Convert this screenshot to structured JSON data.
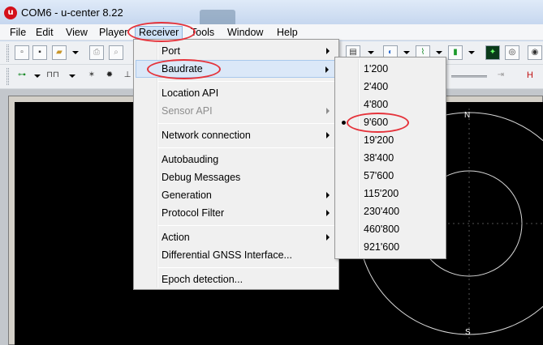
{
  "window": {
    "title": "COM6 - u-center 8.22",
    "logo_text": "u"
  },
  "menubar": {
    "items": [
      {
        "label": "File"
      },
      {
        "label": "Edit"
      },
      {
        "label": "View"
      },
      {
        "label": "Player"
      },
      {
        "label": "Receiver"
      },
      {
        "label": "Tools"
      },
      {
        "label": "Window"
      },
      {
        "label": "Help"
      }
    ],
    "active": "Receiver"
  },
  "receiver_menu": {
    "items": [
      {
        "label": "Port",
        "submenu": true,
        "enabled": true
      },
      {
        "label": "Baudrate",
        "submenu": true,
        "enabled": true,
        "highlighted": true
      },
      {
        "label": "Location API",
        "submenu": false,
        "enabled": true
      },
      {
        "label": "Sensor API",
        "submenu": true,
        "enabled": false
      },
      {
        "label": "Network connection",
        "submenu": true,
        "enabled": true
      },
      {
        "label": "Autobauding",
        "submenu": false,
        "enabled": true
      },
      {
        "label": "Debug Messages",
        "submenu": false,
        "enabled": true
      },
      {
        "label": "Generation",
        "submenu": true,
        "enabled": true
      },
      {
        "label": "Protocol Filter",
        "submenu": true,
        "enabled": true
      },
      {
        "label": "Action",
        "submenu": true,
        "enabled": true
      },
      {
        "label": "Differential GNSS Interface...",
        "submenu": false,
        "enabled": true
      },
      {
        "label": "Epoch detection...",
        "submenu": false,
        "enabled": true
      }
    ]
  },
  "baudrate_menu": {
    "options": [
      "1'200",
      "2'400",
      "4'800",
      "9'600",
      "19'200",
      "38'400",
      "57'600",
      "115'200",
      "230'400",
      "460'800",
      "921'600"
    ],
    "selected": "9'600"
  },
  "sky_view": {
    "north_label": "N",
    "south_label": "S"
  },
  "toolbar": {
    "h_label": "H"
  },
  "accent_colors": {
    "annotation": "#e5333b",
    "menu_highlight": "#dbe8f8"
  }
}
